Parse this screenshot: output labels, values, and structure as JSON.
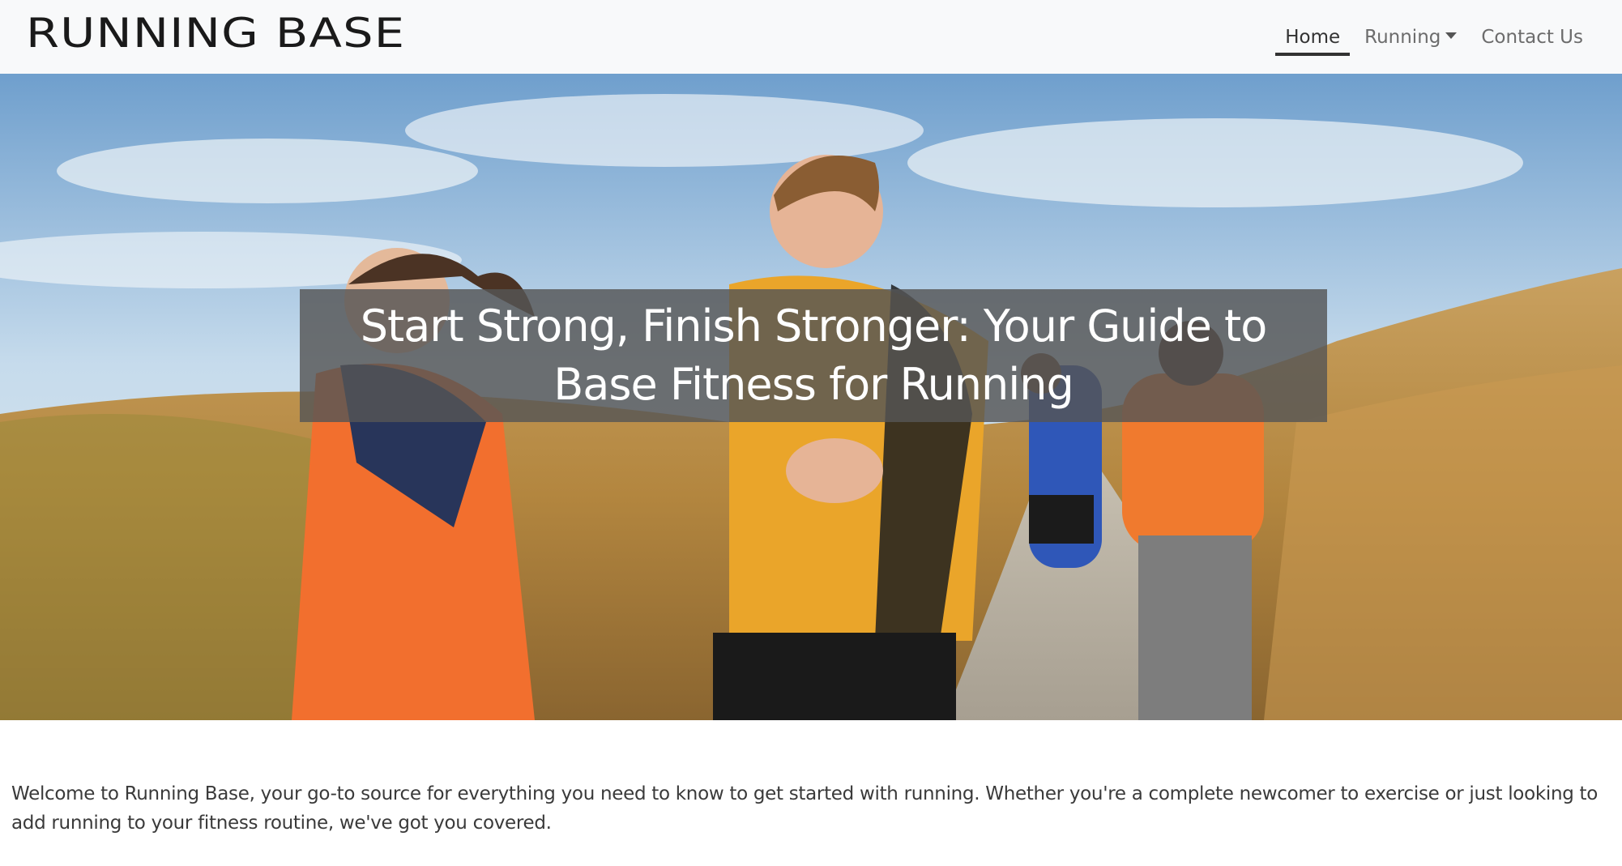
{
  "navbar": {
    "brand": "RUNNING BASE",
    "items": [
      {
        "label": "Home",
        "active": true
      },
      {
        "label": "Running",
        "dropdown": true
      },
      {
        "label": "Contact Us"
      }
    ]
  },
  "hero": {
    "title": "Start Strong, Finish Stronger: Your Guide to Base Fitness for Running",
    "image": "group-of-runners-on-trail-photo"
  },
  "intro": {
    "text": "Welcome to Running Base, your go-to source for everything you need to know to get started with running. Whether you're a complete newcomer to exercise or just looking to add running to your fitness routine, we've got you covered."
  },
  "colors": {
    "navbar_bg": "#f8f9fa",
    "active_underline": "#333333",
    "title_overlay": "#555555"
  }
}
